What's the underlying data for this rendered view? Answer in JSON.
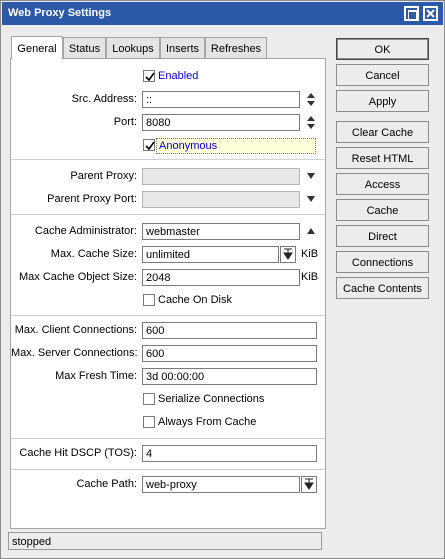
{
  "window": {
    "title": "Web Proxy Settings"
  },
  "tabs": [
    {
      "label": "General"
    },
    {
      "label": "Status"
    },
    {
      "label": "Lookups"
    },
    {
      "label": "Inserts"
    },
    {
      "label": "Refreshes"
    }
  ],
  "form": {
    "enabled": {
      "label": "Enabled",
      "checked": true
    },
    "src_address": {
      "label": "Src. Address:",
      "value": "::"
    },
    "port": {
      "label": "Port:",
      "value": "8080"
    },
    "anonymous": {
      "label": "Anonymous",
      "checked": true
    },
    "parent_proxy": {
      "label": "Parent Proxy:",
      "value": ""
    },
    "parent_proxy_port": {
      "label": "Parent Proxy Port:",
      "value": ""
    },
    "cache_administrator": {
      "label": "Cache Administrator:",
      "value": "webmaster"
    },
    "max_cache_size": {
      "label": "Max. Cache Size:",
      "value": "unlimited",
      "unit": "KiB"
    },
    "max_cache_object_size": {
      "label": "Max Cache Object Size:",
      "value": "2048",
      "unit": "KiB"
    },
    "cache_on_disk": {
      "label": "Cache On Disk",
      "checked": false
    },
    "max_client_connections": {
      "label": "Max. Client Connections:",
      "value": "600"
    },
    "max_server_connections": {
      "label": "Max. Server Connections:",
      "value": "600"
    },
    "max_fresh_time": {
      "label": "Max Fresh Time:",
      "value": "3d 00:00:00"
    },
    "serialize_connections": {
      "label": "Serialize Connections",
      "checked": false
    },
    "always_from_cache": {
      "label": "Always From Cache",
      "checked": false
    },
    "cache_hit_dscp": {
      "label": "Cache Hit DSCP (TOS):",
      "value": "4"
    },
    "cache_path": {
      "label": "Cache Path:",
      "value": "web-proxy"
    }
  },
  "buttons": {
    "ok": "OK",
    "cancel": "Cancel",
    "apply": "Apply",
    "clear_cache": "Clear Cache",
    "reset_html": "Reset HTML",
    "access": "Access",
    "cache": "Cache",
    "direct": "Direct",
    "connections": "Connections",
    "cache_contents": "Cache Contents"
  },
  "status": {
    "text": "stopped"
  },
  "colors": {
    "titlebar": "#2c59a8",
    "link_text": "#0000cc",
    "window_bg": "#ececec"
  }
}
